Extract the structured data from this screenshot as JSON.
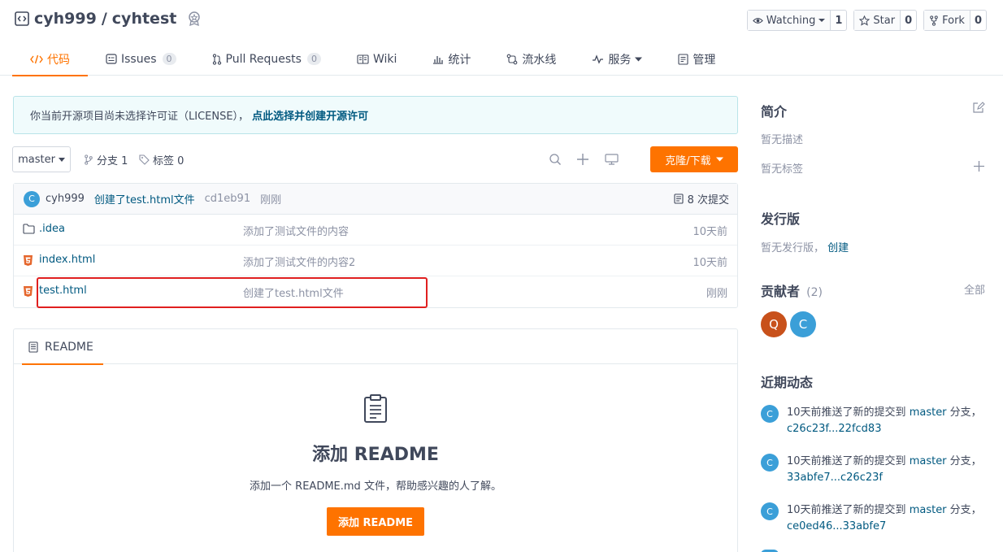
{
  "repo": {
    "owner": "cyh999",
    "separator": "/",
    "name": "cyhtest"
  },
  "actions": [
    {
      "label": "Watching",
      "count": "1",
      "icon": "eye-icon"
    },
    {
      "label": "Star",
      "count": "0",
      "icon": "star-icon"
    },
    {
      "label": "Fork",
      "count": "0",
      "icon": "fork-icon"
    }
  ],
  "tabs": [
    {
      "label": "代码",
      "icon": "code-icon"
    },
    {
      "label": "Issues",
      "count": "0",
      "icon": "issues-icon"
    },
    {
      "label": "Pull Requests",
      "count": "0",
      "icon": "pull-request-icon"
    },
    {
      "label": "Wiki",
      "icon": "wiki-icon"
    },
    {
      "label": "统计",
      "icon": "stats-icon"
    },
    {
      "label": "流水线",
      "icon": "pipeline-icon"
    },
    {
      "label": "服务",
      "icon": "pulse-icon"
    },
    {
      "label": "管理",
      "icon": "manage-icon"
    }
  ],
  "notice": {
    "text": "你当前开源项目尚未选择许可证（LICENSE），",
    "link": "点此选择并创建开源许可"
  },
  "branchbar": {
    "branch": "master",
    "branches": "分支 1",
    "tags": "标签 0",
    "clone": "克隆/下载"
  },
  "commit": {
    "avatar": "C",
    "author": "cyh999",
    "message": "创建了test.html文件",
    "sha": "cd1eb91",
    "time": "刚刚",
    "count": "8 次提交"
  },
  "files": [
    {
      "name": ".idea",
      "message": "添加了测试文件的内容",
      "time": "10天前",
      "type": "folder"
    },
    {
      "name": "index.html",
      "message": "添加了测试文件的内容2",
      "time": "10天前",
      "type": "html"
    },
    {
      "name": "test.html",
      "message": "创建了test.html文件",
      "time": "刚刚",
      "type": "html"
    }
  ],
  "readme": {
    "tab": "README",
    "title": "添加 README",
    "desc": "添加一个 README.md 文件，帮助感兴趣的人了解。",
    "button": "添加 README"
  },
  "sidebar": {
    "intro_title": "简介",
    "no_desc": "暂无描述",
    "no_tags": "暂无标签",
    "release_title": "发行版",
    "no_release": "暂无发行版，",
    "create": "创建",
    "contrib_title": "贡献者",
    "contrib_count": "(2)",
    "all": "全部",
    "contributors": [
      {
        "initial": "Q",
        "color": "#c8511b"
      },
      {
        "initial": "C",
        "color": "#3b9fd8"
      }
    ],
    "activity_title": "近期动态",
    "activities": [
      {
        "avatar": "C",
        "prefix": "10天前推送了新的提交到 ",
        "branch": "master",
        "suffix": " 分支，",
        "range": "c26c23f...22fcd83"
      },
      {
        "avatar": "C",
        "prefix": "10天前推送了新的提交到 ",
        "branch": "master",
        "suffix": " 分支，",
        "range": "33abfe7...c26c23f"
      },
      {
        "avatar": "C",
        "prefix": "10天前推送了新的提交到 ",
        "branch": "master",
        "suffix": " 分支，",
        "range": "ce0ed46...33abfe7"
      }
    ]
  },
  "colors": {
    "accent": "#fe7300",
    "link": "#005980",
    "highlight": "#e02020"
  }
}
